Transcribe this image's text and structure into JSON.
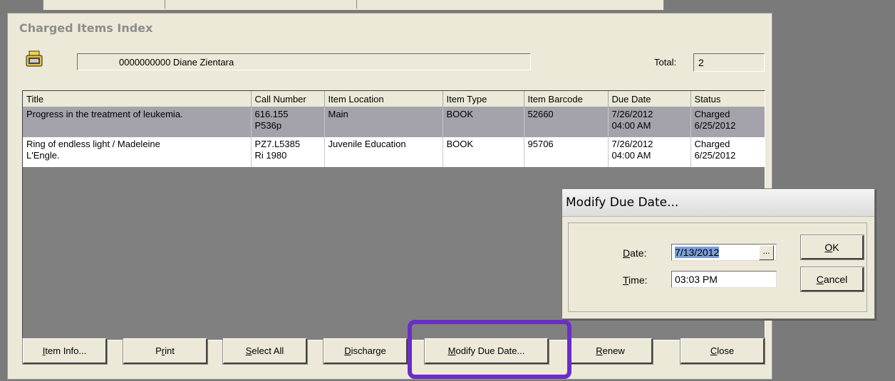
{
  "window": {
    "title": "Charged Items Index",
    "patron": "0000000000 Diane Zientara",
    "total_label": "Total:",
    "total_value": "2"
  },
  "table": {
    "columns": [
      "Title",
      "Call Number",
      "Item Location",
      "Item Type",
      "Item Barcode",
      "Due Date",
      "Status"
    ],
    "rows": [
      {
        "title_l1": "Progress in the treatment of leukemia.",
        "title_l2": "",
        "call_l1": "616.155",
        "call_l2": "P536p",
        "location": "Main",
        "type": "BOOK",
        "barcode": "52660",
        "due_l1": "7/26/2012",
        "due_l2": "04:00 AM",
        "status_l1": "Charged",
        "status_l2": "6/25/2012"
      },
      {
        "title_l1": "Ring of endless light / Madeleine",
        "title_l2": "L'Engle.",
        "call_l1": "PZ7.L5385",
        "call_l2": "Ri 1980",
        "location": "Juvenile Education",
        "type": "BOOK",
        "barcode": "95706",
        "due_l1": "7/26/2012",
        "due_l2": "04:00 AM",
        "status_l1": "Charged",
        "status_l2": "6/25/2012"
      }
    ]
  },
  "buttons": {
    "item_info_u": "I",
    "item_info_rest": "tem Info...",
    "print_a": "P",
    "print_u": "r",
    "print_rest": "int",
    "select_all_u": "S",
    "select_all_rest": "elect All",
    "discharge_u": "D",
    "discharge_rest": "ischarge",
    "modify_u": "M",
    "modify_rest": "odify Due Date...",
    "renew_u": "R",
    "renew_rest": "enew",
    "close_u": "C",
    "close_rest": "lose"
  },
  "dialog": {
    "title": "Modify Due Date...",
    "date_label_u": "D",
    "date_label_rest": "ate:",
    "date_value": "7/13/2012",
    "time_label_u": "T",
    "time_label_rest": "ime:",
    "time_value": "03:03 PM",
    "ellipsis": "...",
    "ok_u": "O",
    "ok_rest": "K",
    "cancel_u": "C",
    "cancel_rest": "ancel"
  },
  "colors": {
    "selected_row": "#a4a2aa",
    "highlight": "#6a2dc7"
  },
  "icons": {
    "patron": "cash-register-icon"
  }
}
